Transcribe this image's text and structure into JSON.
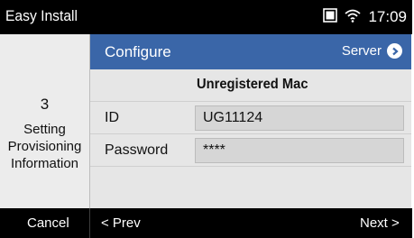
{
  "status_bar": {
    "title": "Easy Install",
    "time": "17:09"
  },
  "side": {
    "step_number": "3",
    "step_line1": "Setting",
    "step_line2": "Provisioning",
    "step_line3": "Information"
  },
  "header": {
    "title": "Configure",
    "link_label": "Server"
  },
  "content": {
    "subtitle": "Unregistered Mac",
    "id_label": "ID",
    "id_value": "UG11124",
    "password_label": "Password",
    "password_value": "****"
  },
  "softkeys": {
    "cancel": "Cancel",
    "prev": "< Prev",
    "next": "Next >"
  }
}
